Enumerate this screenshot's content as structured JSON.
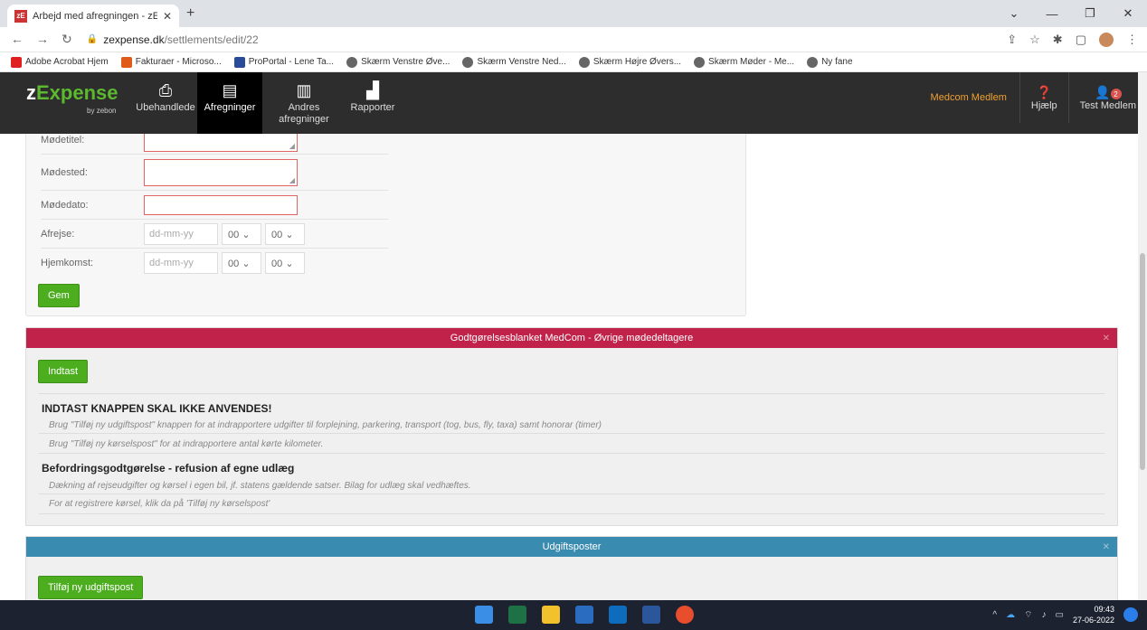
{
  "browser": {
    "tab_title": "Arbejd med afregningen - zExpe",
    "tab_favicon": "zE",
    "url_host": "zexpense.dk",
    "url_path": "/settlements/edit/22",
    "bookmarks": [
      {
        "label": "Adobe Acrobat Hjem",
        "color": "#e02020"
      },
      {
        "label": "Fakturaer - Microso...",
        "color": "#e05a1a"
      },
      {
        "label": "ProPortal - Lene Ta...",
        "color": "#2a4a9a"
      },
      {
        "label": "Skærm Venstre Øve...",
        "color": "#666666"
      },
      {
        "label": "Skærm Venstre Ned...",
        "color": "#666666"
      },
      {
        "label": "Skærm Højre Øvers...",
        "color": "#666666"
      },
      {
        "label": "Skærm Møder - Me...",
        "color": "#666666"
      },
      {
        "label": "Ny fane",
        "color": "#666666"
      }
    ]
  },
  "app": {
    "logo": {
      "z": "z",
      "expense": "Expense",
      "by": "by zebon"
    },
    "nav": [
      {
        "label": "Ubehandlede",
        "icon": "inbox-icon"
      },
      {
        "label": "Afregninger",
        "icon": "document-icon"
      },
      {
        "label": "Andres afregninger",
        "icon": "documents-icon"
      },
      {
        "label": "Rapporter",
        "icon": "bar-chart-icon"
      }
    ],
    "org": "Medcom Medlem",
    "help": "Hjælp",
    "user": "Test Medlem",
    "user_badge": "2"
  },
  "form": {
    "fields": [
      {
        "label": "Mødetitel:"
      },
      {
        "label": "Mødested:"
      },
      {
        "label": "Mødedato:"
      }
    ],
    "afrejse": {
      "label": "Afrejse:",
      "date_placeholder": "dd-mm-yy",
      "hour": "00",
      "minute": "00"
    },
    "hjemkomst": {
      "label": "Hjemkomst:",
      "date_placeholder": "dd-mm-yy",
      "hour": "00",
      "minute": "00"
    },
    "save_label": "Gem"
  },
  "panel_red": {
    "title": "Godtgørelsesblanket MedCom - Øvrige mødedeltagere",
    "button": "Indtast",
    "heading1": "INDTAST KNAPPEN SKAL IKKE ANVENDES!",
    "note1": "Brug \"Tilføj ny udgiftspost\" knappen for at indrapportere udgifter til forplejning, parkering, transport (tog, bus, fly, taxa) samt honorar (timer)",
    "note2": "Brug \"Tilføj ny kørselspost\" for at indrapportere antal kørte kilometer.",
    "heading2": "Befordringsgodtgørelse - refusion af egne udlæg",
    "note3": "Dækning af rejseudgifter og kørsel i egen bil, jf. statens gældende satser. Bilag for udlæg skal vedhæftes.",
    "note4": "For at registrere kørsel, klik da på 'Tilføj ny kørselspost'"
  },
  "panel_blue": {
    "title": "Udgiftsposter",
    "button": "Tilføj ny udgiftspost"
  },
  "taskbar": {
    "time": "09:43",
    "date": "27-06-2022"
  }
}
